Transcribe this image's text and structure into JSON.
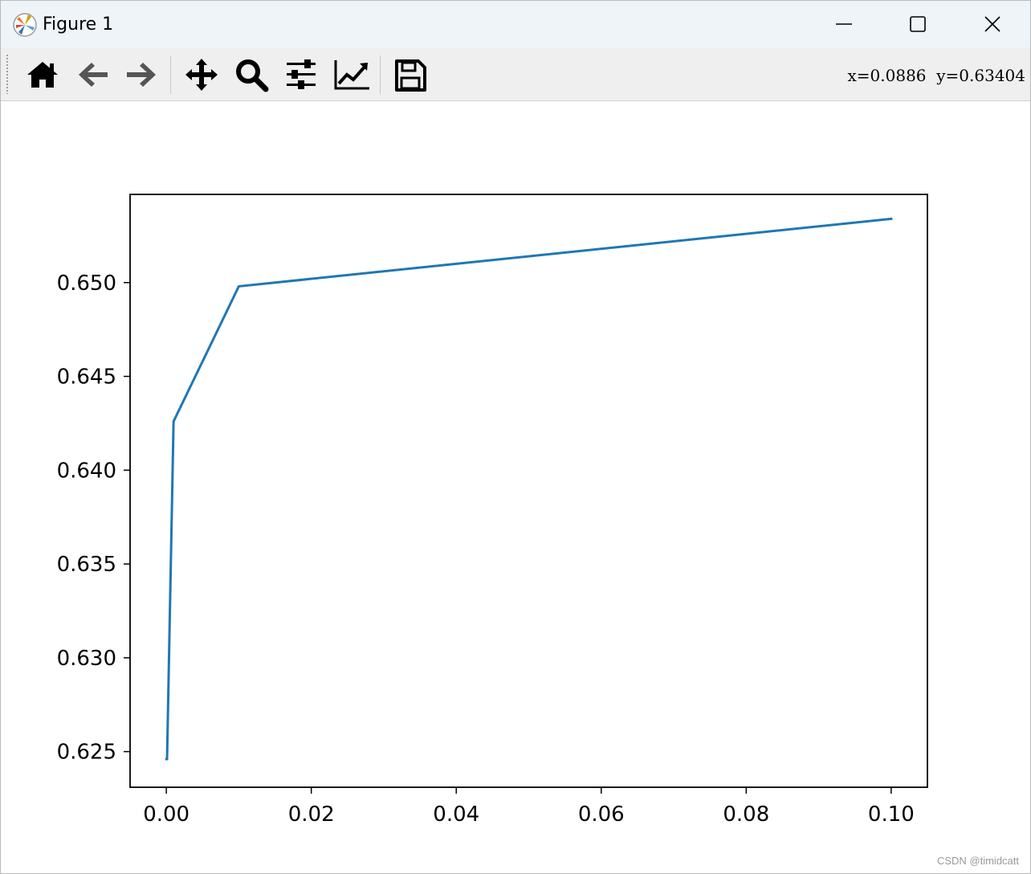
{
  "window": {
    "title": "Figure 1",
    "app_icon": "matplotlib-logo-icon",
    "controls": [
      "minimize-icon",
      "maximize-icon",
      "close-icon"
    ]
  },
  "toolbar": {
    "tools": [
      {
        "name": "home",
        "icon": "home-icon"
      },
      {
        "name": "back",
        "icon": "arrow-left-icon"
      },
      {
        "name": "forward",
        "icon": "arrow-right-icon"
      },
      {
        "name": "pan",
        "icon": "move-icon"
      },
      {
        "name": "zoom",
        "icon": "magnifier-icon"
      },
      {
        "name": "configure-subplots",
        "icon": "sliders-icon"
      },
      {
        "name": "edit-axis",
        "icon": "line-chart-icon"
      },
      {
        "name": "save",
        "icon": "floppy-disk-icon"
      }
    ],
    "coordinates": "x=0.0886  y=0.63404"
  },
  "colors": {
    "line": "#1f77b4",
    "titlebar": "#eef4f8",
    "toolbar": "#efefef"
  },
  "chart_data": {
    "type": "line",
    "title": "",
    "xlabel": "",
    "ylabel": "",
    "xlim": [
      -0.005,
      0.105
    ],
    "ylim": [
      0.6231,
      0.6547
    ],
    "grid": false,
    "x_ticks": [
      0.0,
      0.02,
      0.04,
      0.06,
      0.08,
      0.1
    ],
    "x_tick_labels": [
      "0.00",
      "0.02",
      "0.04",
      "0.06",
      "0.08",
      "0.10"
    ],
    "y_ticks": [
      0.625,
      0.63,
      0.635,
      0.64,
      0.645,
      0.65
    ],
    "y_tick_labels": [
      "0.625",
      "0.630",
      "0.635",
      "0.640",
      "0.645",
      "0.650"
    ],
    "series": [
      {
        "x": [
          1e-05,
          0.0001,
          0.001,
          0.01,
          0.1
        ],
        "y": [
          0.6246,
          0.6246,
          0.6426,
          0.6498,
          0.6534
        ]
      }
    ]
  },
  "watermark": "CSDN @timidcatt"
}
